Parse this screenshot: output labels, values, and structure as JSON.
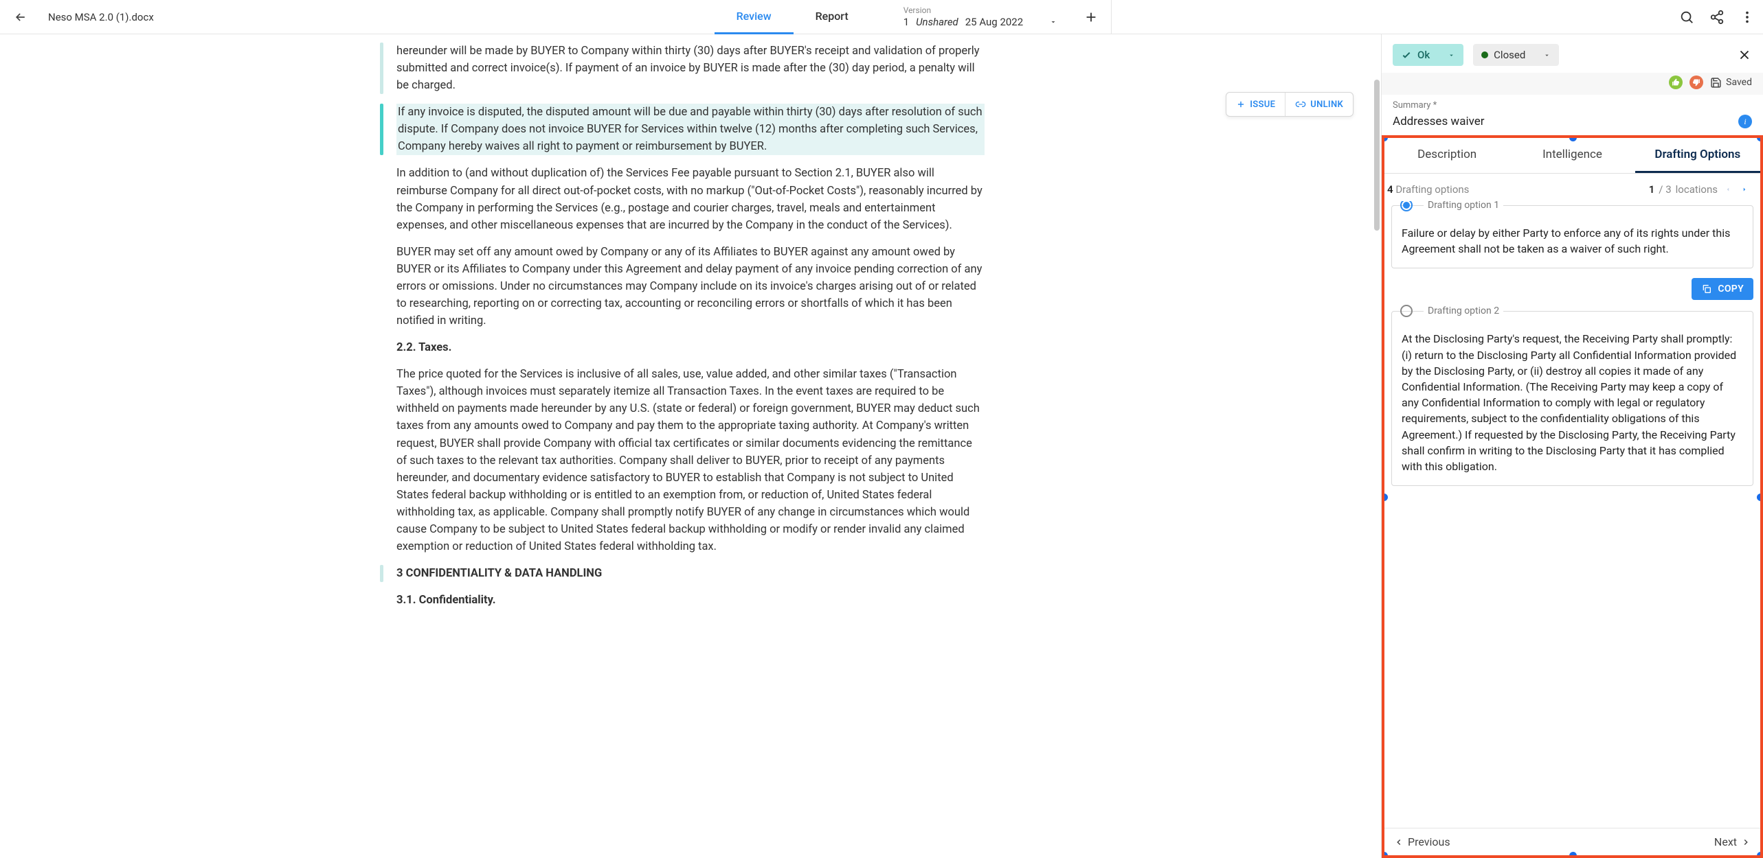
{
  "header": {
    "doc_title": "Neso MSA 2.0 (1).docx",
    "tabs": {
      "review": "Review",
      "report": "Report"
    },
    "version": {
      "label": "Version",
      "number": "1",
      "status": "Unshared",
      "date": "25 Aug 2022"
    }
  },
  "toolbar": {
    "issue": "ISSUE",
    "unlink": "UNLINK"
  },
  "doc": {
    "p0": "hereunder will be made by BUYER to Company within thirty (30) days after BUYER's receipt and validation of properly submitted and correct invoice(s). If payment of an invoice by BUYER is made after the (30) day period, a penalty will be charged.",
    "p1": "If any invoice is disputed, the disputed amount will be due and payable within thirty (30) days after resolution of such dispute. If Company does not invoice BUYER for Services within twelve (12) months after completing such Services, Company hereby waives all right to payment or reimbursement by BUYER.",
    "p2": "In addition to (and without duplication of) the Services Fee payable pursuant to Section 2.1, BUYER also will reimburse Company for all direct out-of-pocket costs, with no markup (\"Out-of-Pocket Costs\"), reasonably incurred by the Company in performing the Services (e.g., postage and courier charges, travel, meals and entertainment expenses, and other miscellaneous expenses that are incurred by the Company in the conduct of the Services).",
    "p3": "BUYER may set off any amount owed by Company or any of its Affiliates to BUYER against any amount owed by BUYER or its Affiliates to Company under this Agreement and delay payment of any invoice pending correction of any errors or omissions. Under no circumstances may Company include on its invoice's charges arising out of or related to researching, reporting on or correcting tax, accounting or reconciling errors or shortfalls of which it has been notified in writing.",
    "h1": "2.2.   Taxes.",
    "p4": "The price quoted for the Services is inclusive of all sales, use, value added, and other similar taxes (\"Transaction Taxes\"), although invoices must separately itemize all Transaction Taxes.  In the event taxes are required to be withheld on payments made hereunder by any U.S. (state or federal) or foreign government, BUYER may deduct such taxes from any amounts owed to Company and pay them to the appropriate taxing authority. At Company's written request, BUYER shall provide Company with official tax certificates or similar documents evidencing the remittance of such taxes to the relevant tax authorities. Company shall deliver to BUYER, prior to receipt of any payments hereunder, and documentary evidence satisfactory to BUYER to establish that Company is not subject to United States federal backup withholding or is entitled to an exemption from, or reduction of, United States federal withholding tax, as applicable. Company shall promptly notify BUYER of any change in circumstances which would cause Company to be subject to United States federal backup withholding or modify or render invalid any claimed exemption or reduction of United States federal withholding tax.",
    "h2": "3 CONFIDENTIALITY & DATA HANDLING",
    "h3": "3.1.   Confidentiality."
  },
  "side": {
    "status_ok": "Ok",
    "status_closed": "Closed",
    "saved": "Saved",
    "summary_label": "Summary *",
    "summary_text": "Addresses waiver",
    "tabs": {
      "description": "Description",
      "intelligence": "Intelligence",
      "drafting": "Drafting Options"
    },
    "subhead": {
      "options_count": "4",
      "options_label": "Drafting options",
      "loc_current": "1",
      "loc_sep": "/ 3",
      "loc_label": "locations"
    },
    "options": [
      {
        "label": "Drafting option 1",
        "selected": true,
        "body": "Failure or delay by either Party to enforce any of its rights under this Agreement shall not be taken as a waiver of such right."
      },
      {
        "label": "Drafting option 2",
        "selected": false,
        "body": "At the Disclosing Party's request, the Receiving Party shall promptly: (i) return to the Disclosing Party all Confidential Information provided by the Disclosing Party, or (ii) destroy all copies it made of any Confidential Information. (The Receiving Party may keep a copy of any Confidential Information to comply with legal or regulatory requirements, subject to the confidentiality obligations of this Agreement.) If requested by the Disclosing Party, the Receiving Party shall confirm in writing to the Disclosing Party that it has complied with this obligation."
      }
    ],
    "copy": "COPY",
    "prev": "Previous",
    "next": "Next"
  }
}
